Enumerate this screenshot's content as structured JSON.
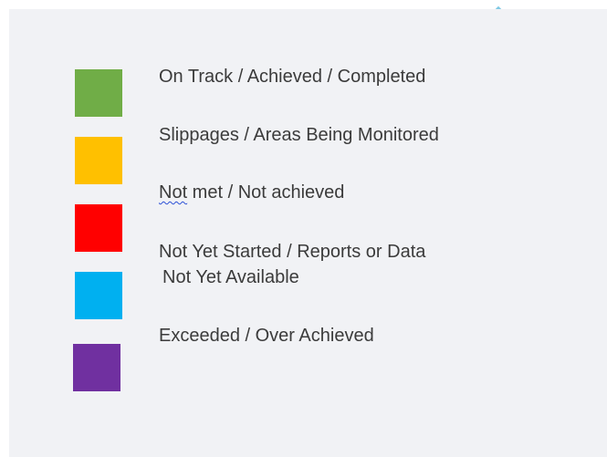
{
  "legend": {
    "items": [
      {
        "color": "#70ad47",
        "label": "On Track / Achieved / Completed"
      },
      {
        "color": "#ffc000",
        "label": "Slippages / Areas Being Monitored"
      },
      {
        "color": "#ff0000",
        "label_word": "Not",
        "label_rest": " met / Not achieved"
      },
      {
        "color": "#00b0f0",
        "label_line1": "Not Yet Started / Reports or Data",
        "label_line2": "Not Yet Available"
      },
      {
        "color": "#7030a0",
        "label": "Exceeded / Over Achieved"
      }
    ]
  }
}
